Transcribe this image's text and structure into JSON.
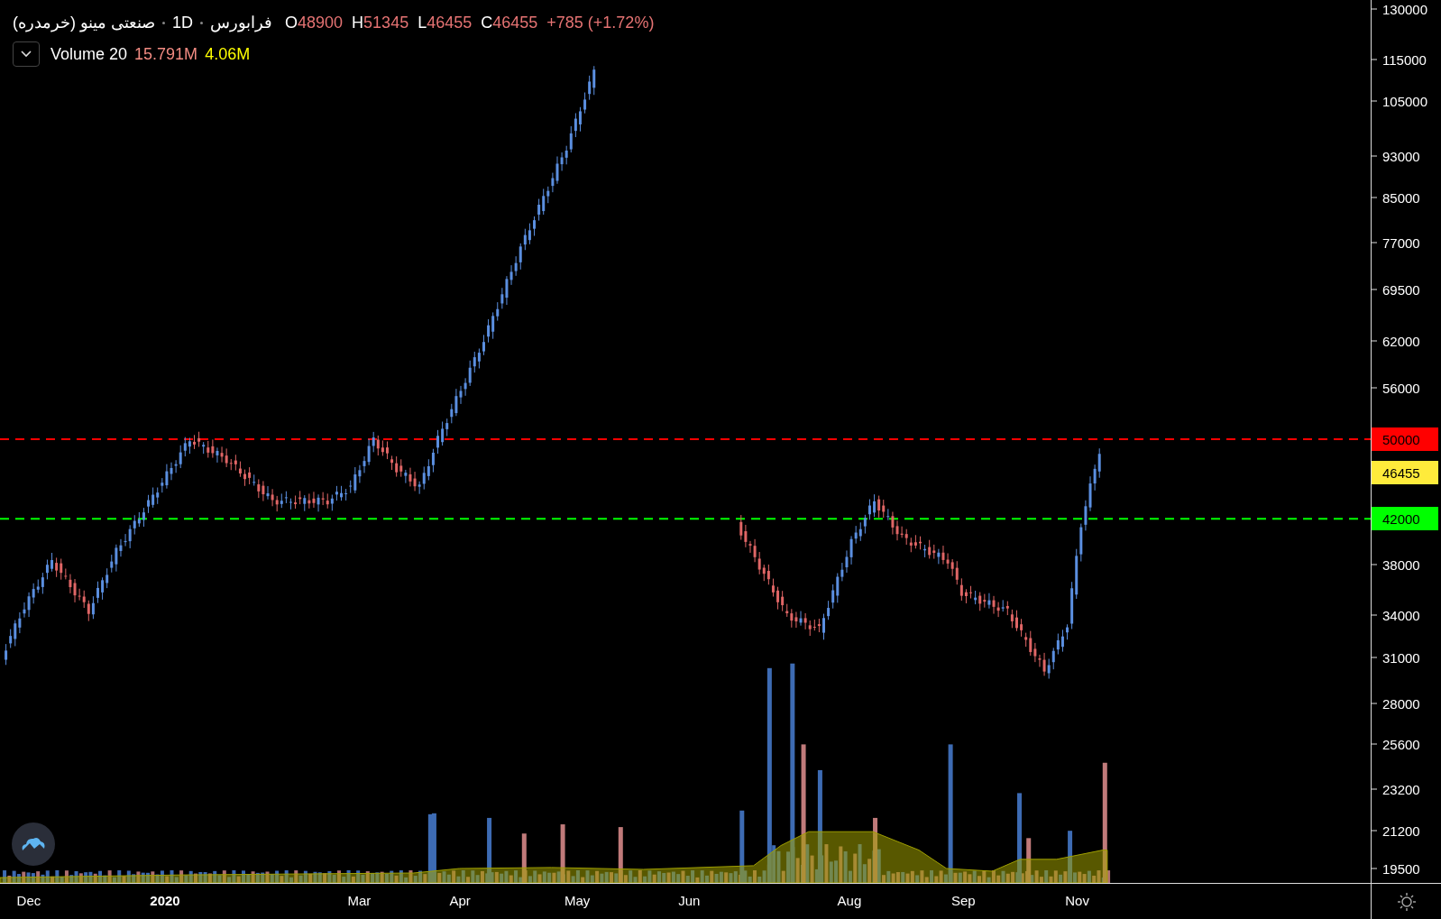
{
  "legend": {
    "symbol": "صنعتی مینو (خرمدره)",
    "interval": "1D",
    "exchange": "فرابورس",
    "ohlc": [
      {
        "key": "O",
        "value": "48900"
      },
      {
        "key": "H",
        "value": "51345"
      },
      {
        "key": "L",
        "value": "46455"
      },
      {
        "key": "C",
        "value": "46455"
      }
    ],
    "change": "+785 (+1.72%)"
  },
  "volume_legend": {
    "name": "Volume 20",
    "values": [
      {
        "text": "15.791M",
        "color": "#f28b82"
      },
      {
        "text": "4.06M",
        "color": "#ffff00"
      }
    ]
  },
  "price_axis": {
    "ticks": [
      "130000",
      "115000",
      "105000",
      "93000",
      "85000",
      "77000",
      "69500",
      "62000",
      "56000",
      "38000",
      "34000",
      "31000",
      "28000",
      "25600",
      "23200",
      "21200",
      "19500"
    ],
    "markers": [
      {
        "label": "50000",
        "color": "#ff0000",
        "kind": "line"
      },
      {
        "label": "46455",
        "color": "#ffeb3b",
        "kind": "badge"
      },
      {
        "label": "42000",
        "color": "#00ff00",
        "kind": "line"
      }
    ]
  },
  "time_axis": [
    {
      "text": "Dec",
      "kind": "month"
    },
    {
      "text": "2020",
      "kind": "year"
    },
    {
      "text": "Mar",
      "kind": "month"
    },
    {
      "text": "Apr",
      "kind": "month"
    },
    {
      "text": "May",
      "kind": "month"
    },
    {
      "text": "Jun",
      "kind": "month"
    },
    {
      "text": "Aug",
      "kind": "month"
    },
    {
      "text": "Sep",
      "kind": "month"
    },
    {
      "text": "Nov",
      "kind": "month"
    }
  ]
}
